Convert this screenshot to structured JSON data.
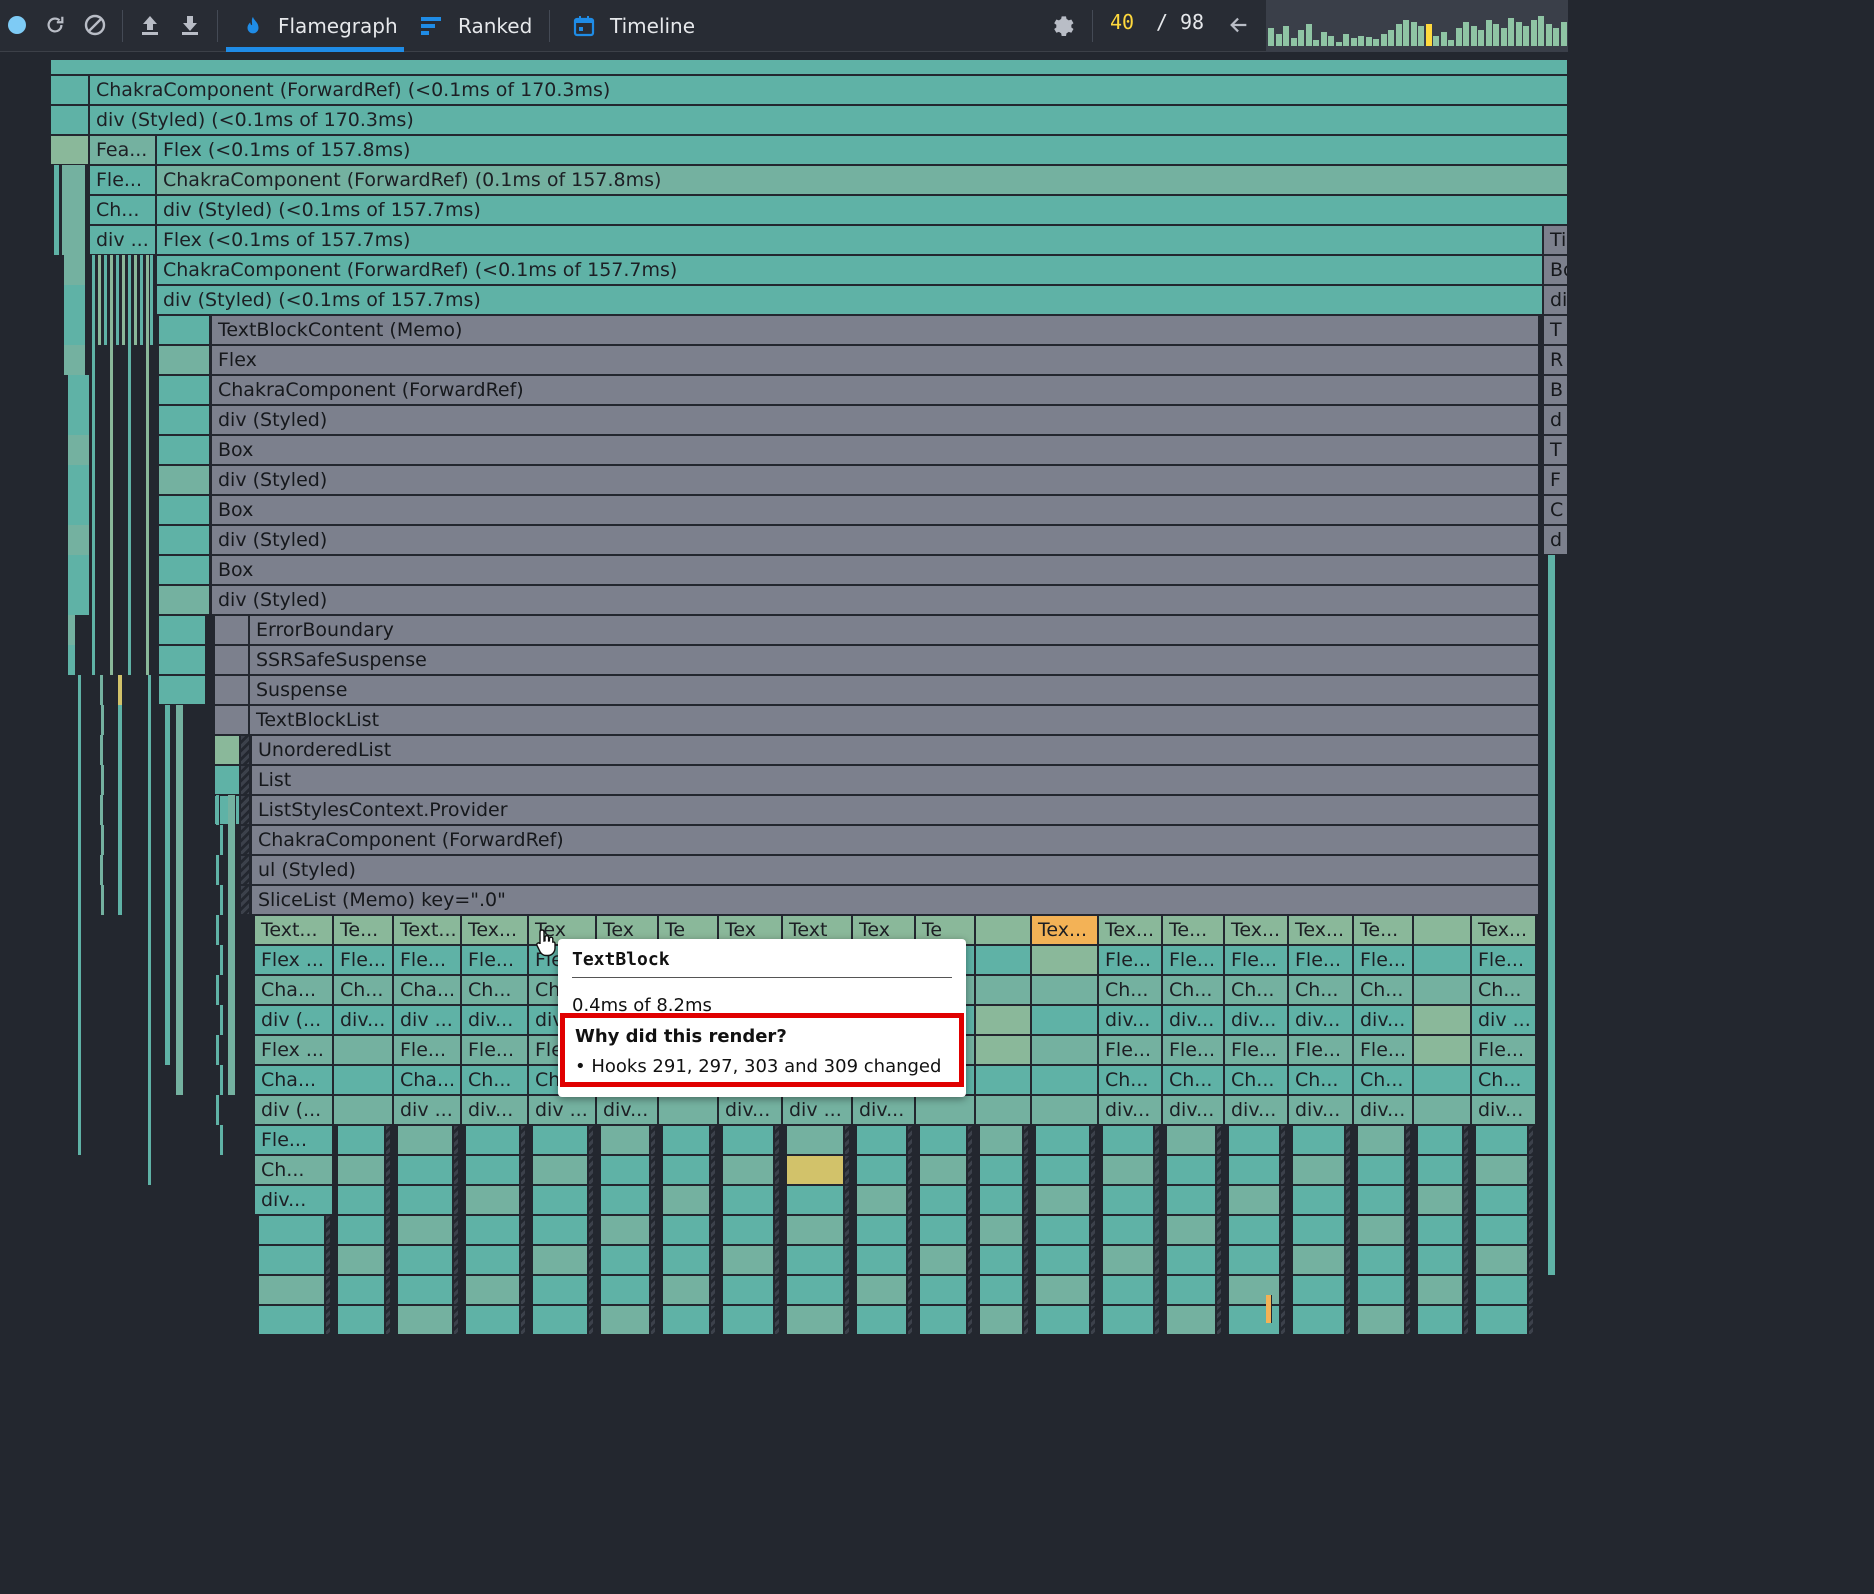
{
  "toolbar": {
    "tabs": [
      {
        "label": "Flamegraph",
        "icon": "flame-icon",
        "active": true
      },
      {
        "label": "Ranked",
        "icon": "ranked-icon",
        "active": false
      },
      {
        "label": "Timeline",
        "icon": "calendar-icon",
        "active": false
      }
    ],
    "commit_current": "40",
    "commit_separator": "/",
    "commit_total": "98",
    "record_color": "#7ecbf5",
    "accent": "#1f8ce6"
  },
  "flamegraph": {
    "row_labels": [
      "ChakraComponent (ForwardRef) (<0.1ms of 170.3ms)",
      "div (Styled) (<0.1ms of 170.3ms)",
      "Flex (<0.1ms of 157.8ms)",
      "ChakraComponent (ForwardRef) (0.1ms of 157.8ms)",
      "div (Styled) (<0.1ms of 157.7ms)",
      "Flex (<0.1ms of 157.7ms)",
      "ChakraComponent (ForwardRef) (<0.1ms of 157.7ms)",
      "div (Styled) (<0.1ms of 157.7ms)",
      "TextBlockContent (Memo)",
      "Flex",
      "ChakraComponent (ForwardRef)",
      "div (Styled)",
      "Box",
      "div (Styled)",
      "Box",
      "div (Styled)",
      "Box",
      "div (Styled)",
      "ErrorBoundary",
      "SSRSafeSuspense",
      "Suspense",
      "TextBlockList",
      "UnorderedList",
      "List",
      "ListStylesContext.Provider",
      "ChakraComponent (ForwardRef)",
      "ul (Styled)",
      "SliceList (Memo) key=\".0\""
    ],
    "side_labels": [
      "Fea...",
      "Fle...",
      "Ch...",
      "div ..."
    ],
    "right_edge_labels": [
      "Ti",
      "Bo",
      "di",
      "T",
      "R",
      "B",
      "d",
      "T",
      "F",
      "C",
      "d"
    ],
    "columns": [
      {
        "labels": [
          "Text...",
          "Flex ...",
          "Cha...",
          "div (...",
          "Flex ...",
          "Cha...",
          "div (...",
          "Fle...",
          "Ch...",
          "div..."
        ]
      },
      {
        "labels": [
          "Te...",
          "Fle...",
          "Ch...",
          "div...",
          "",
          "",
          "",
          "",
          "",
          ""
        ]
      },
      {
        "labels": [
          "Text...",
          "Fle...",
          "Cha...",
          "div ...",
          "Fle...",
          "Cha...",
          "div ...",
          "",
          "",
          ""
        ]
      },
      {
        "labels": [
          "Tex...",
          "Fle...",
          "Ch...",
          "div...",
          "Fle...",
          "Ch...",
          "div...",
          "",
          "",
          ""
        ]
      },
      {
        "labels": [
          "Tex",
          "Fle",
          "Ch",
          "div",
          "Fle",
          "Ch",
          "div ...",
          "",
          "",
          ""
        ]
      },
      {
        "labels": [
          "Tex",
          "",
          "",
          "",
          "",
          "",
          "div...",
          "",
          "",
          ""
        ]
      },
      {
        "labels": [
          "Te",
          "",
          "",
          "",
          "",
          "",
          "",
          "",
          "",
          ""
        ]
      },
      {
        "labels": [
          "Tex",
          "Fle...",
          "Ch...",
          "",
          "",
          "",
          "div...",
          "",
          "",
          ""
        ]
      },
      {
        "labels": [
          "Text",
          "Flex...",
          "Cha...",
          "div ...",
          "",
          "",
          "div ...",
          "",
          "",
          ""
        ]
      },
      {
        "labels": [
          "Tex",
          "Fle...",
          "Ch...",
          "div...",
          "",
          "",
          "div...",
          "",
          "",
          ""
        ]
      },
      {
        "labels": [
          "Te",
          "",
          "",
          "",
          "",
          "",
          "",
          "",
          "",
          ""
        ]
      },
      {
        "labels": [
          "",
          "",
          "",
          "",
          "",
          "",
          "",
          "",
          "",
          ""
        ]
      },
      {
        "labels": [
          "Tex...",
          "",
          "",
          "",
          "",
          "",
          "",
          "",
          "",
          ""
        ]
      },
      {
        "labels": [
          "Tex...",
          "Fle...",
          "Ch...",
          "div...",
          "Fle...",
          "Ch...",
          "div...",
          "",
          "",
          ""
        ]
      },
      {
        "labels": [
          "Te...",
          "Fle...",
          "Ch...",
          "div...",
          "Fle...",
          "Ch...",
          "div...",
          "",
          "",
          ""
        ]
      },
      {
        "labels": [
          "Tex...",
          "Fle...",
          "Ch...",
          "div...",
          "Fle...",
          "Ch...",
          "div...",
          "",
          "",
          ""
        ]
      },
      {
        "labels": [
          "Tex...",
          "Fle...",
          "Ch...",
          "div...",
          "Fle...",
          "Ch...",
          "div...",
          "",
          "",
          ""
        ]
      },
      {
        "labels": [
          "Te...",
          "Fle...",
          "Ch...",
          "div...",
          "Fle...",
          "Ch...",
          "div...",
          "",
          "",
          ""
        ]
      },
      {
        "labels": [
          "",
          "",
          "",
          "",
          "",
          "",
          "",
          "",
          "",
          ""
        ]
      },
      {
        "labels": [
          "Tex...",
          "Fle...",
          "Ch...",
          "div ...",
          "Fle...",
          "Ch...",
          "div...",
          "",
          "",
          ""
        ]
      }
    ]
  },
  "tooltip": {
    "title": "TextBlock",
    "time": "0.4ms of 8.2ms",
    "why_heading": "Why did this render?",
    "reason": "• Hooks 291, 297, 303 and 309 changed"
  }
}
